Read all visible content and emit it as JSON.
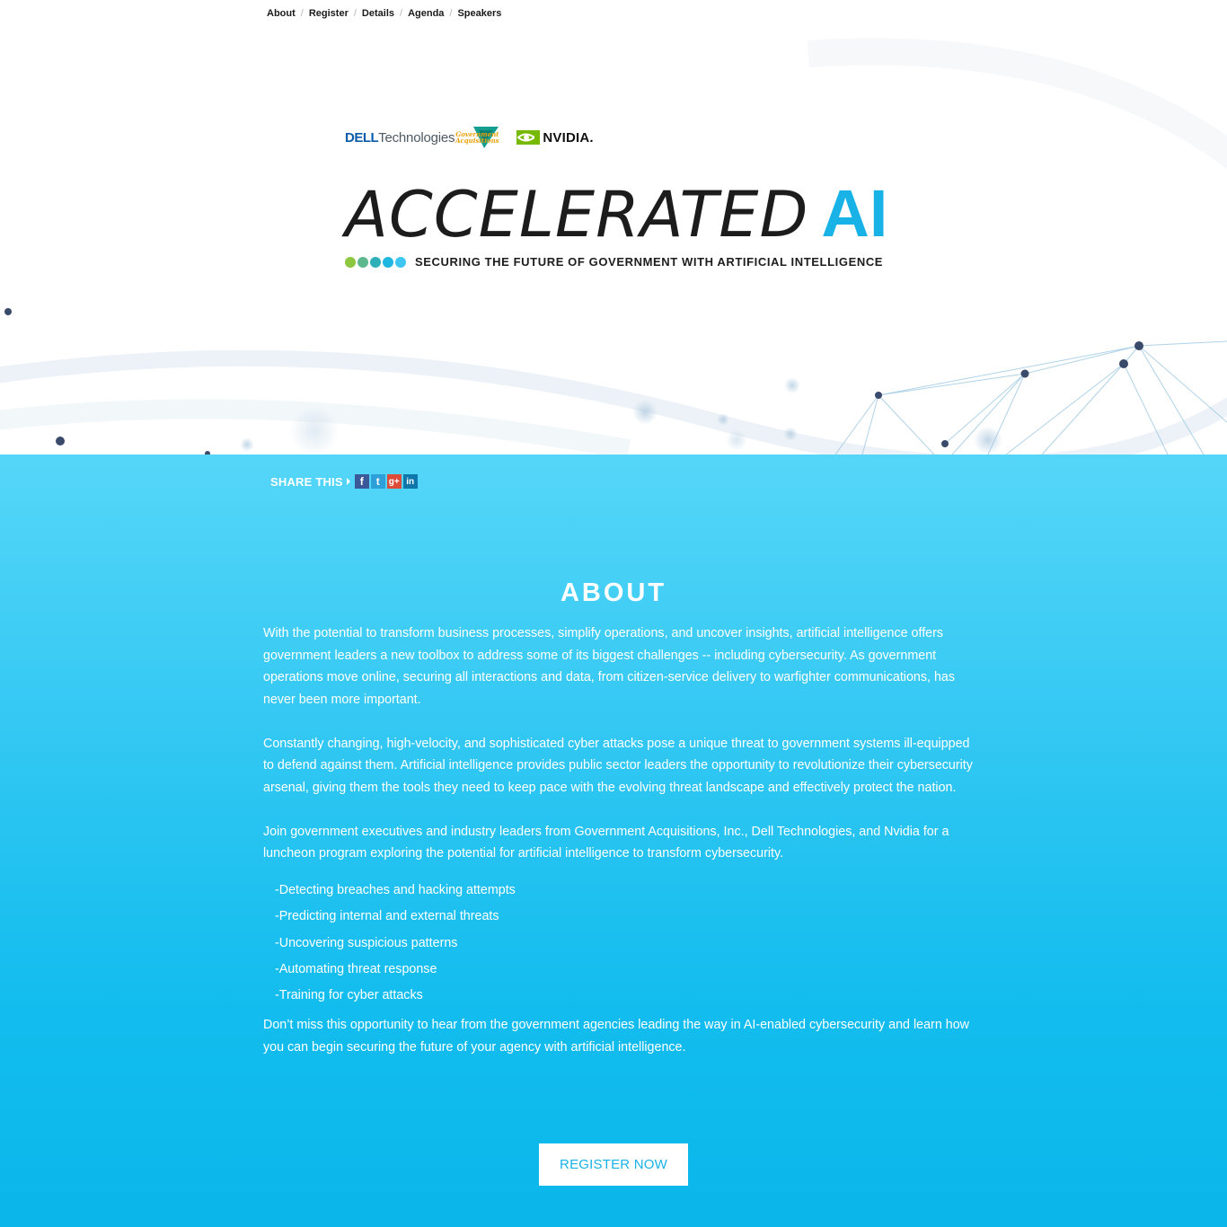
{
  "nav": {
    "items": [
      {
        "label": "About"
      },
      {
        "label": "Register"
      },
      {
        "label": "Details"
      },
      {
        "label": "Agenda"
      },
      {
        "label": "Speakers"
      }
    ],
    "separator": "/"
  },
  "hero": {
    "sponsors": {
      "dell": {
        "brand": "DELL",
        "suffix": "Technologies"
      },
      "gov": {
        "line1": "Government",
        "line2": "Acquisitions"
      },
      "nvidia": {
        "label": "NVIDIA."
      }
    },
    "title_light": "ACCELERATED",
    "title_bold": "AI",
    "tagline": "SECURING THE FUTURE OF GOVERNMENT WITH ARTIFICIAL INTELLIGENCE",
    "dot_colors": [
      "#8dc63f",
      "#5db88e",
      "#2fb0b8",
      "#1fb6e0",
      "#3ec6f0"
    ]
  },
  "share": {
    "label": "SHARE THIS",
    "buttons": [
      {
        "icon": "facebook-icon",
        "glyph": "f",
        "color": "#3b5998"
      },
      {
        "icon": "twitter-icon",
        "glyph": "t",
        "color": "#2d9fd9"
      },
      {
        "icon": "google-plus-icon",
        "glyph": "g+",
        "color": "#dd4b39"
      },
      {
        "icon": "linkedin-icon",
        "glyph": "in",
        "color": "#0e76a8"
      }
    ]
  },
  "about": {
    "heading": "ABOUT",
    "paragraphs": [
      "With the potential to transform business processes, simplify operations, and uncover insights, artificial intelligence offers government leaders a new toolbox to address some of its biggest challenges -- including cybersecurity. As government operations move online, securing all interactions and data, from citizen-service delivery to warfighter communications, has never been more important.",
      "Constantly changing, high-velocity, and sophisticated cyber attacks pose a unique threat to government systems ill-equipped to defend against them. Artificial intelligence provides public sector leaders the opportunity to revolutionize their cybersecurity arsenal, giving them the tools they need to keep pace with the evolving threat landscape and effectively protect the nation.",
      "Join government executives and industry leaders from Government Acquisitions, Inc., Dell Technologies, and Nvidia for a luncheon program exploring the potential for artificial intelligence to transform cybersecurity."
    ],
    "list": [
      "-Detecting breaches and hacking attempts",
      "-Predicting internal and external threats",
      "-Uncovering suspicious patterns",
      "-Automating threat response",
      "-Training for cyber attacks"
    ],
    "closing": "Don’t miss this opportunity to hear from the government agencies leading the way in AI-enabled cybersecurity and learn how you can begin securing the future of your agency with artificial intelligence."
  },
  "cta": {
    "label": "REGISTER NOW"
  },
  "colors": {
    "accent": "#19b2e6",
    "blue_top": "#55d6f8",
    "blue_bottom": "#0ab6ea"
  }
}
